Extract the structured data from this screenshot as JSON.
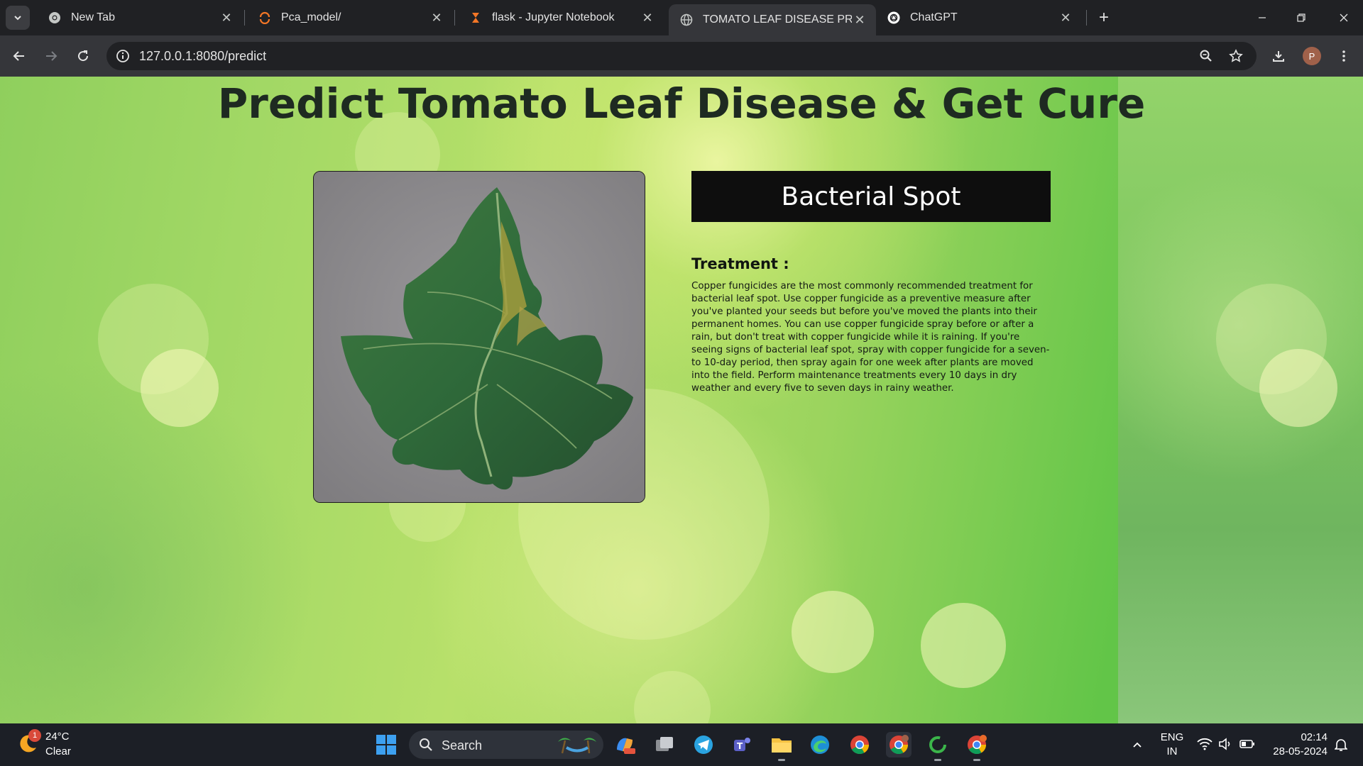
{
  "browser": {
    "tabs": [
      {
        "title": "New Tab",
        "icon": "chrome-icon"
      },
      {
        "title": "Pca_model/",
        "icon": "jupyter-icon"
      },
      {
        "title": "flask - Jupyter Notebook",
        "icon": "hourglass-icon"
      },
      {
        "title": "TOMATO LEAF DISEASE PREDIC",
        "icon": "globe-icon",
        "active": true
      },
      {
        "title": "ChatGPT",
        "icon": "chatgpt-icon"
      }
    ],
    "url": "127.0.0.1:8080/predict",
    "profile_initial": "P"
  },
  "page": {
    "title": "Predict Tomato Leaf Disease & Get Cure",
    "result": "Bacterial Spot",
    "treatment_heading": "Treatment :",
    "treatment_text": "Copper fungicides are the most commonly recommended treatment for bacterial leaf spot. Use copper fungicide as a preventive measure after you've planted your seeds but before you've moved the plants into their permanent homes. You can use copper fungicide spray before or after a rain, but don't treat with copper fungicide while it is raining. If you're seeing signs of bacterial leaf spot, spray with copper fungicide for a seven- to 10-day period, then spray again for one week after plants are moved into the field. Perform maintenance treatments every 10 days in dry weather and every five to seven days in rainy weather."
  },
  "taskbar": {
    "weather_temp": "24°C",
    "weather_condition": "Clear",
    "weather_badge": "1",
    "search_label": "Search",
    "language_line1": "ENG",
    "language_line2": "IN",
    "time": "02:14",
    "date": "28-05-2024"
  }
}
